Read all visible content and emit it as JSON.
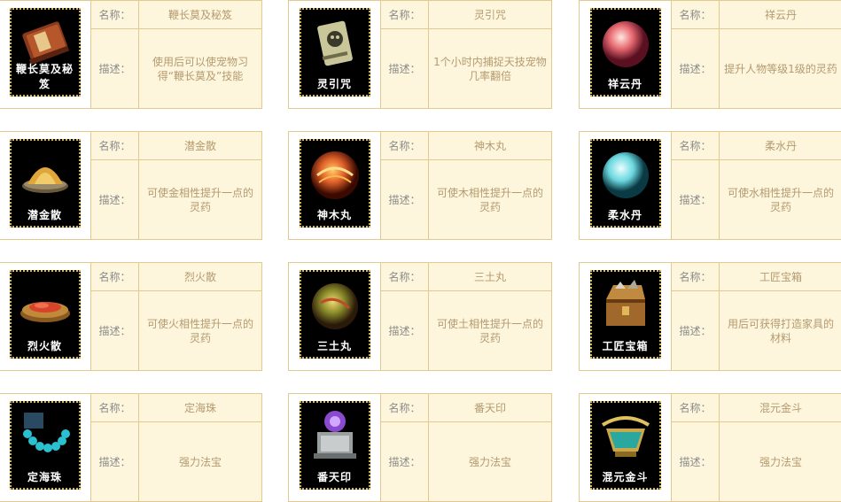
{
  "labels": {
    "name": "名称：",
    "desc": "描述："
  },
  "items": [
    {
      "name": "鞭长莫及秘笈",
      "thumb": "鞭长莫及秘笈",
      "desc": "使用后可以使宠物习得“鞭长莫及”技能",
      "icon": "book-icon"
    },
    {
      "name": "灵引咒",
      "thumb": "灵引咒",
      "desc": "1个小时内捕捉天技宠物几率翻倍",
      "icon": "scroll-icon"
    },
    {
      "name": "祥云丹",
      "thumb": "祥云丹",
      "desc": "提升人物等级1级的灵药",
      "icon": "pink-orb-icon"
    },
    {
      "name": "潜金散",
      "thumb": "潜金散",
      "desc": "可使金相性提升一点的灵药",
      "icon": "gold-powder-icon"
    },
    {
      "name": "神木丸",
      "thumb": "神木丸",
      "desc": "可使木相性提升一点的灵药",
      "icon": "fire-orb-icon"
    },
    {
      "name": "柔水丹",
      "thumb": "柔水丹",
      "desc": "可使水相性提升一点的灵药",
      "icon": "water-orb-icon"
    },
    {
      "name": "烈火散",
      "thumb": "烈火散",
      "desc": "可使火相性提升一点的灵药",
      "icon": "red-powder-icon"
    },
    {
      "name": "三土丸",
      "thumb": "三土丸",
      "desc": "可使土相性提升一点的灵药",
      "icon": "earth-orb-icon"
    },
    {
      "name": "工匠宝箱",
      "thumb": "工匠宝箱",
      "desc": "用后可获得打造家具的材料",
      "icon": "chest-icon"
    },
    {
      "name": "定海珠",
      "thumb": "定海珠",
      "desc": "强力法宝",
      "icon": "bead-necklace-icon"
    },
    {
      "name": "番天印",
      "thumb": "番天印",
      "desc": "强力法宝",
      "icon": "seal-icon"
    },
    {
      "name": "混元金斗",
      "thumb": "混元金斗",
      "desc": "强力法宝",
      "icon": "golden-dou-icon"
    }
  ]
}
